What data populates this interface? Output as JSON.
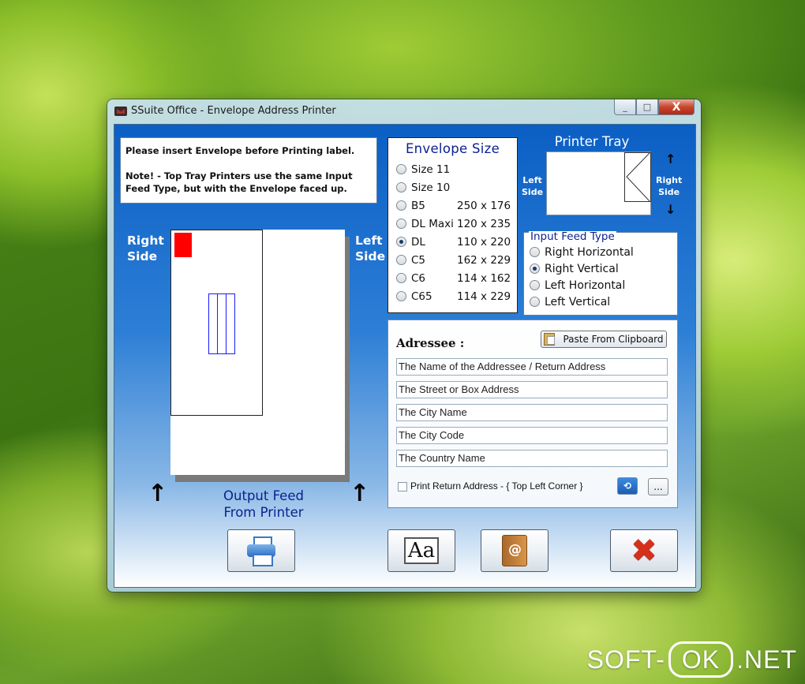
{
  "window": {
    "title": "SSuite Office - Envelope Address Printer",
    "min": "_",
    "max": "□",
    "close": "X"
  },
  "note": {
    "line1": "Please insert Envelope before Printing label.",
    "line2": "Note!  -  Top Tray Printers use the same Input Feed Type, but  with the Envelope faced up."
  },
  "preview": {
    "right_side": [
      "Right",
      "Side"
    ],
    "left_side": [
      "Left",
      "Side"
    ],
    "output_feed": [
      "Output Feed",
      "From Printer"
    ],
    "arrow": "↑"
  },
  "envelope_size": {
    "title": "Envelope Size",
    "options": [
      {
        "label": "Size 11",
        "dims": "",
        "checked": false
      },
      {
        "label": "Size 10",
        "dims": "",
        "checked": false
      },
      {
        "label": "B5",
        "dims": "250 x 176",
        "checked": false
      },
      {
        "label": "DL Maxi",
        "dims": "120 x 235",
        "checked": false
      },
      {
        "label": "DL",
        "dims": "110 x 220",
        "checked": true
      },
      {
        "label": "C5",
        "dims": "162 x 229",
        "checked": false
      },
      {
        "label": "C6",
        "dims": "114 x 162",
        "checked": false
      },
      {
        "label": "C65",
        "dims": "114 x 229",
        "checked": false
      }
    ]
  },
  "printer_tray": {
    "title": "Printer Tray",
    "left": [
      "Left",
      "Side"
    ],
    "right": [
      "Right",
      "Side"
    ],
    "up": "↑",
    "down": "↓"
  },
  "input_feed": {
    "legend": "Input Feed Type",
    "options": [
      {
        "label": "Right Horizontal",
        "checked": false
      },
      {
        "label": "Right Vertical",
        "checked": true
      },
      {
        "label": "Left Horizontal",
        "checked": false
      },
      {
        "label": "Left Vertical",
        "checked": false
      }
    ]
  },
  "addressee": {
    "title": "Adressee :",
    "paste_label": "Paste From Clipboard",
    "fields": [
      "The Name of the Addressee / Return Address",
      "The Street or Box Address",
      "The City Name",
      "The City Code",
      "The Country Name"
    ],
    "return_label": "Print Return Address - { Top Left Corner }",
    "return_checked": false,
    "more_label": "..."
  },
  "toolbar": {
    "print_icon": "printer-icon",
    "font_label": "Aa",
    "contacts_icon": "address-book-icon",
    "exit_label": "✖"
  },
  "watermark": {
    "left": "SOFT-",
    "ok": "OK",
    "right": ".NET"
  }
}
